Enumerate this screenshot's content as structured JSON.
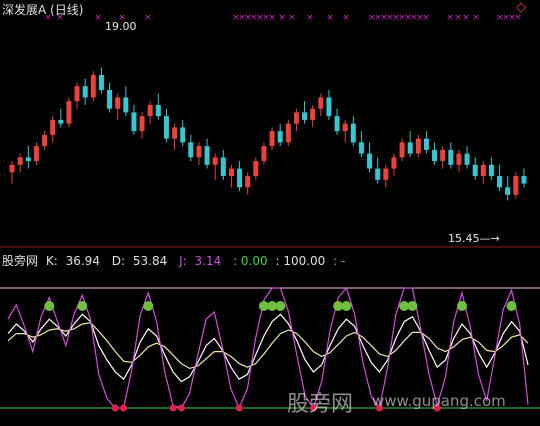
{
  "title": "深发展A (日线)",
  "indicator": {
    "name": "股旁网",
    "k_label": "K:",
    "k_value": "36.94",
    "d_label": "D:",
    "d_value": "53.84",
    "j_label": "J:",
    "j_value": "3.14",
    "v4": ": 0.00",
    "v5": ": 100.00",
    "v6": ": -"
  },
  "watermark": "股旁网",
  "watermark_url": "www.gupang.com",
  "colors": {
    "up": "#e8443a",
    "down": "#35c8d2",
    "k": "#ffffff",
    "d": "#f2e6a6",
    "j": "#d050d8",
    "upper_line": "#f0c8e8",
    "lower_line": "#40d040",
    "divider": "#8a1a1a",
    "marker": "#d020c0",
    "buy_badge": "#70c040",
    "sell_badge": "#e02050"
  },
  "chart_data": [
    {
      "type": "candlestick",
      "title": "深发展A (日线)",
      "annotations": [
        {
          "text": "19.00",
          "kind": "high"
        },
        {
          "text": "15.45",
          "kind": "low"
        }
      ],
      "ylim": [
        14.5,
        20.0
      ],
      "candles": [
        [
          16.2,
          16.5,
          15.9,
          16.4
        ],
        [
          16.4,
          16.7,
          16.2,
          16.6
        ],
        [
          16.6,
          16.9,
          16.3,
          16.5
        ],
        [
          16.5,
          17.0,
          16.4,
          16.9
        ],
        [
          16.9,
          17.3,
          16.8,
          17.2
        ],
        [
          17.2,
          17.7,
          17.0,
          17.6
        ],
        [
          17.6,
          17.9,
          17.4,
          17.5
        ],
        [
          17.5,
          18.2,
          17.4,
          18.1
        ],
        [
          18.1,
          18.6,
          17.9,
          18.5
        ],
        [
          18.5,
          18.7,
          18.0,
          18.2
        ],
        [
          18.2,
          18.9,
          18.1,
          18.8
        ],
        [
          18.8,
          19.0,
          18.3,
          18.4
        ],
        [
          18.4,
          18.6,
          17.8,
          17.9
        ],
        [
          17.9,
          18.3,
          17.6,
          18.2
        ],
        [
          18.2,
          18.5,
          17.7,
          17.8
        ],
        [
          17.8,
          18.0,
          17.2,
          17.3
        ],
        [
          17.3,
          17.8,
          17.1,
          17.7
        ],
        [
          17.7,
          18.1,
          17.5,
          18.0
        ],
        [
          18.0,
          18.3,
          17.6,
          17.7
        ],
        [
          17.7,
          17.9,
          17.0,
          17.1
        ],
        [
          17.1,
          17.5,
          16.8,
          17.4
        ],
        [
          17.4,
          17.6,
          16.9,
          17.0
        ],
        [
          17.0,
          17.2,
          16.5,
          16.6
        ],
        [
          16.6,
          17.0,
          16.4,
          16.9
        ],
        [
          16.9,
          17.1,
          16.3,
          16.4
        ],
        [
          16.4,
          16.7,
          16.0,
          16.6
        ],
        [
          16.6,
          16.8,
          16.0,
          16.1
        ],
        [
          16.1,
          16.4,
          15.8,
          16.3
        ],
        [
          16.3,
          16.5,
          15.7,
          15.8
        ],
        [
          15.8,
          16.2,
          15.6,
          16.1
        ],
        [
          16.1,
          16.6,
          16.0,
          16.5
        ],
        [
          16.5,
          17.0,
          16.4,
          16.9
        ],
        [
          16.9,
          17.4,
          16.8,
          17.3
        ],
        [
          17.3,
          17.5,
          16.9,
          17.0
        ],
        [
          17.0,
          17.6,
          16.9,
          17.5
        ],
        [
          17.5,
          17.9,
          17.3,
          17.8
        ],
        [
          17.8,
          18.1,
          17.5,
          17.6
        ],
        [
          17.6,
          18.0,
          17.4,
          17.9
        ],
        [
          17.9,
          18.3,
          17.7,
          18.2
        ],
        [
          18.2,
          18.4,
          17.6,
          17.7
        ],
        [
          17.7,
          17.9,
          17.2,
          17.3
        ],
        [
          17.3,
          17.6,
          17.0,
          17.5
        ],
        [
          17.5,
          17.7,
          16.9,
          17.0
        ],
        [
          17.0,
          17.3,
          16.6,
          16.7
        ],
        [
          16.7,
          17.0,
          16.2,
          16.3
        ],
        [
          16.3,
          16.6,
          15.9,
          16.0
        ],
        [
          16.0,
          16.4,
          15.8,
          16.3
        ],
        [
          16.3,
          16.7,
          16.1,
          16.6
        ],
        [
          16.6,
          17.1,
          16.5,
          17.0
        ],
        [
          17.0,
          17.3,
          16.6,
          16.7
        ],
        [
          16.7,
          17.2,
          16.6,
          17.1
        ],
        [
          17.1,
          17.3,
          16.7,
          16.8
        ],
        [
          16.8,
          17.0,
          16.4,
          16.5
        ],
        [
          16.5,
          16.9,
          16.3,
          16.8
        ],
        [
          16.8,
          17.0,
          16.3,
          16.4
        ],
        [
          16.4,
          16.8,
          16.2,
          16.7
        ],
        [
          16.7,
          16.9,
          16.3,
          16.4
        ],
        [
          16.4,
          16.6,
          16.0,
          16.1
        ],
        [
          16.1,
          16.5,
          15.9,
          16.4
        ],
        [
          16.4,
          16.6,
          16.0,
          16.1
        ],
        [
          16.1,
          16.4,
          15.7,
          15.8
        ],
        [
          15.8,
          16.1,
          15.45,
          15.6
        ],
        [
          15.6,
          16.2,
          15.5,
          16.1
        ],
        [
          16.1,
          16.3,
          15.8,
          15.9
        ]
      ]
    },
    {
      "type": "line",
      "title": "股旁网",
      "ylim": [
        0,
        100
      ],
      "series": [
        {
          "name": "K",
          "values": [
            62,
            70,
            64,
            55,
            66,
            74,
            68,
            60,
            70,
            78,
            72,
            52,
            40,
            30,
            24,
            36,
            55,
            66,
            60,
            44,
            30,
            22,
            26,
            38,
            52,
            58,
            48,
            34,
            24,
            28,
            44,
            60,
            72,
            78,
            70,
            56,
            40,
            30,
            36,
            52,
            66,
            74,
            68,
            52,
            38,
            30,
            40,
            58,
            72,
            76,
            64,
            48,
            34,
            40,
            58,
            70,
            62,
            46,
            34,
            46,
            62,
            72,
            64,
            36
          ]
        },
        {
          "name": "D",
          "values": [
            56,
            62,
            62,
            59,
            61,
            65,
            66,
            64,
            66,
            70,
            71,
            64,
            56,
            47,
            39,
            38,
            44,
            51,
            54,
            51,
            44,
            37,
            33,
            35,
            41,
            47,
            47,
            43,
            37,
            34,
            37,
            45,
            54,
            62,
            65,
            62,
            55,
            47,
            43,
            46,
            53,
            60,
            63,
            59,
            52,
            45,
            43,
            48,
            56,
            63,
            63,
            58,
            50,
            47,
            51,
            57,
            59,
            55,
            48,
            47,
            52,
            59,
            61,
            54
          ]
        },
        {
          "name": "J",
          "values": [
            74,
            86,
            68,
            47,
            76,
            92,
            72,
            52,
            78,
            94,
            74,
            28,
            8,
            0,
            0,
            32,
            77,
            96,
            72,
            30,
            2,
            0,
            12,
            44,
            74,
            80,
            50,
            16,
            0,
            16,
            58,
            90,
            100,
            100,
            80,
            44,
            10,
            0,
            22,
            64,
            92,
            100,
            78,
            38,
            10,
            0,
            34,
            78,
            100,
            100,
            66,
            28,
            2,
            26,
            72,
            96,
            68,
            28,
            6,
            44,
            82,
            98,
            70,
            3
          ]
        }
      ]
    }
  ]
}
